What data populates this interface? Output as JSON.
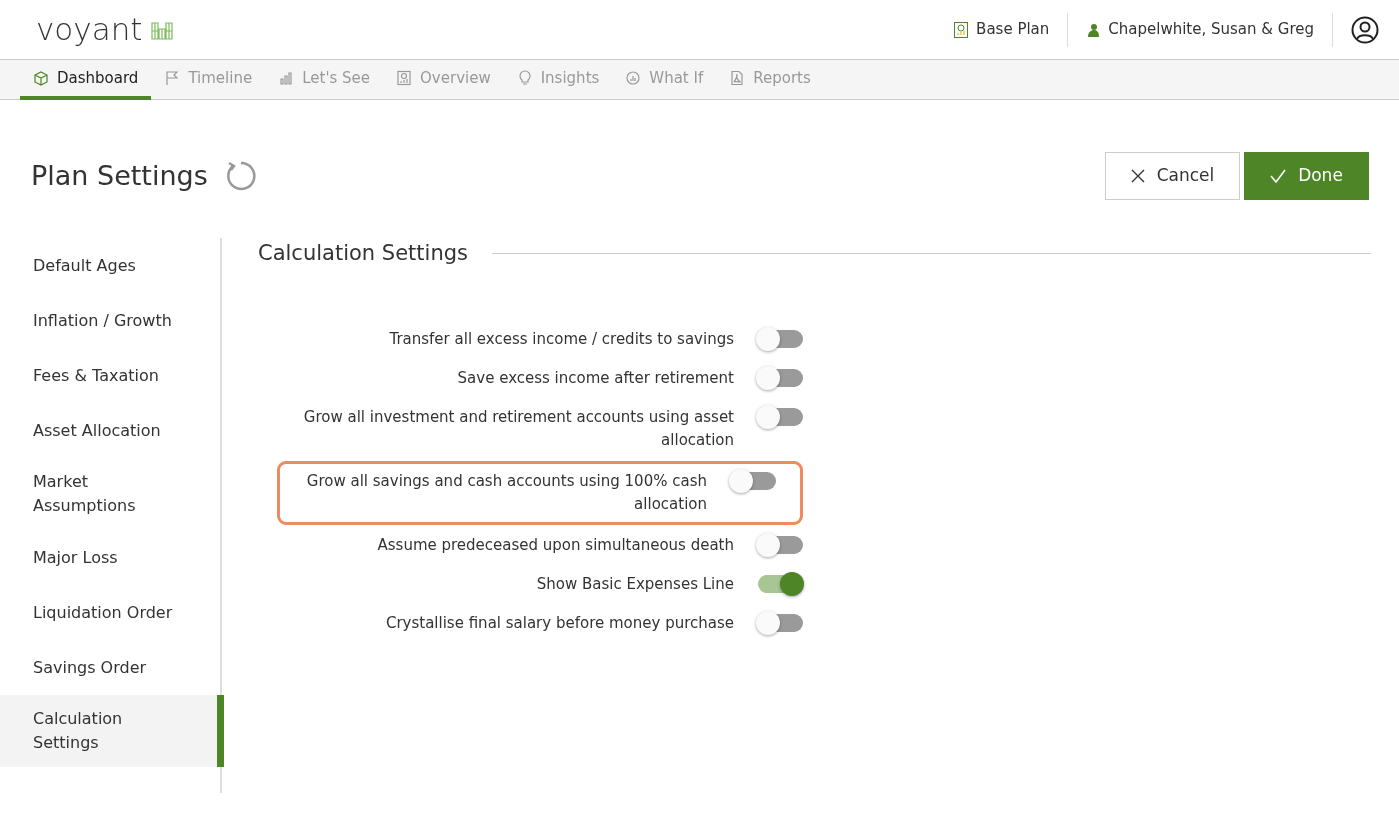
{
  "brand": {
    "name": "voyant"
  },
  "header": {
    "plan": "Base Plan",
    "client": "Chapelwhite, Susan & Greg"
  },
  "tabs": [
    {
      "label": "Dashboard",
      "kind": "box",
      "selected": true
    },
    {
      "label": "Timeline",
      "kind": "flag",
      "selected": false
    },
    {
      "label": "Let's See",
      "kind": "bars",
      "selected": false
    },
    {
      "label": "Overview",
      "kind": "report",
      "selected": false
    },
    {
      "label": "Insights",
      "kind": "bulb",
      "selected": false
    },
    {
      "label": "What If",
      "kind": "gauge",
      "selected": false
    },
    {
      "label": "Reports",
      "kind": "pdf",
      "selected": false
    }
  ],
  "page": {
    "title": "Plan Settings",
    "buttons": [
      {
        "label": "Cancel",
        "kind": "cancel"
      },
      {
        "label": "Done",
        "kind": "done"
      }
    ]
  },
  "sidebar": {
    "items": [
      {
        "label": "Default Ages",
        "selected": false
      },
      {
        "label": "Inflation / Growth",
        "selected": false
      },
      {
        "label": "Fees & Taxation",
        "selected": false
      },
      {
        "label": "Asset Allocation",
        "selected": false
      },
      {
        "label": "Market Assumptions",
        "selected": false
      },
      {
        "label": "Major Loss",
        "selected": false
      },
      {
        "label": "Liquidation Order",
        "selected": false
      },
      {
        "label": "Savings Order",
        "selected": false
      },
      {
        "label": "Calculation Settings",
        "selected": true
      }
    ]
  },
  "section": {
    "title": "Calculation Settings",
    "settings": [
      {
        "label": "Transfer all excess income / credits to savings",
        "on": false,
        "highlighted": false
      },
      {
        "label": "Save excess income after retirement",
        "on": false,
        "highlighted": false
      },
      {
        "label": "Grow all investment and retirement accounts using asset allocation",
        "on": false,
        "highlighted": false
      },
      {
        "label": "Grow all savings and cash accounts using 100% cash allocation",
        "on": false,
        "highlighted": true
      },
      {
        "label": "Assume predeceased upon simultaneous death",
        "on": false,
        "highlighted": false
      },
      {
        "label": "Show Basic Expenses Line",
        "on": true,
        "highlighted": false
      },
      {
        "label": "Crystallise final salary before money purchase",
        "on": false,
        "highlighted": false
      }
    ]
  }
}
